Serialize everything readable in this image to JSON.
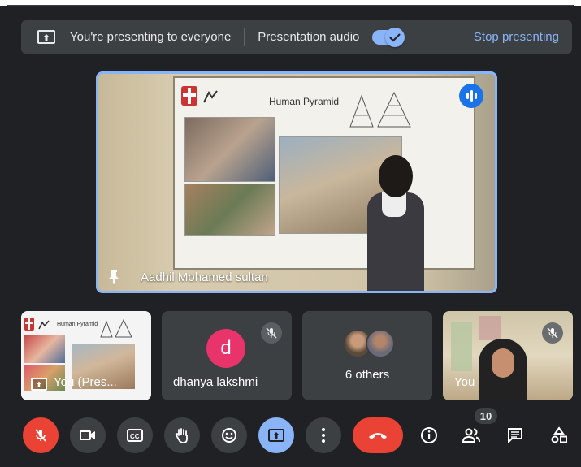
{
  "banner": {
    "presenting_text": "You're presenting to everyone",
    "audio_label": "Presentation audio",
    "audio_enabled": true,
    "stop_label": "Stop presenting"
  },
  "main_tile": {
    "participant_name": "Aadhil Mohamed sultan",
    "slide_title": "Human Pyramid",
    "pinned": true,
    "speaking": true
  },
  "tiles": [
    {
      "name": "You (Pres...",
      "type": "presentation",
      "slide_title": "Human Pyramid"
    },
    {
      "name": "dhanya lakshmi",
      "initial": "d",
      "avatar_color": "#e8336b",
      "muted": true
    },
    {
      "name": "6 others",
      "type": "group"
    },
    {
      "name": "You",
      "muted": true
    }
  ],
  "controls": {
    "people_count": "10",
    "mic_muted": true,
    "presenting": true
  },
  "colors": {
    "accent": "#8ab4f8",
    "danger": "#ea4335",
    "surface": "#3c4043",
    "background": "#202124"
  }
}
